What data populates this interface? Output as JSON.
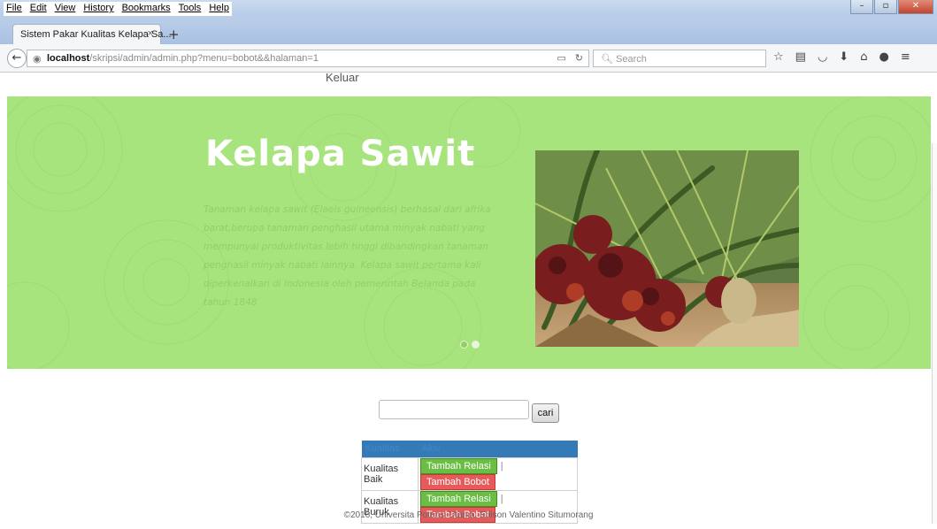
{
  "browser": {
    "menu": [
      "File",
      "Edit",
      "View",
      "History",
      "Bookmarks",
      "Tools",
      "Help"
    ],
    "tab_title": "Sistem Pakar Kualitas Kelapa Sa...",
    "tab_close": "×",
    "new_tab": "+",
    "url_host": "localhost",
    "url_path": "/skripsi/admin/admin.php?menu=bobot&&halaman=1",
    "search_placeholder": "Search",
    "toolbar_icons": [
      "star-icon",
      "bookmarks-list-icon",
      "pocket-icon",
      "download-icon",
      "home-icon",
      "hello-icon",
      "menu-icon"
    ]
  },
  "page": {
    "logout_label": "Keluar",
    "hero": {
      "title": "Kelapa Sawit",
      "description": "Tanaman kelapa sawit (Elaeis guineensis) berhasal dari afrika barat,berupa tanaman penghasil utama minyak nabati yang mempunyai produktivitas lebih tinggi dibandingkan tanaman penghasil minyak nabati lainnya. Kelapa sawit pertama kali diperkenalkan di Indonesia oleh pemerintah Belanda pada tahun 1848",
      "background_color": "#a8e47e",
      "slide_count": 2,
      "active_slide": 1
    },
    "search": {
      "input_value": "",
      "button_label": "cari"
    },
    "table": {
      "headers": [
        "Kualitas",
        "Aksi"
      ],
      "rows": [
        {
          "kualitas": "Kualitas Baik",
          "relasi_label": "Tambah Relasi",
          "separator": "|",
          "bobot_label": "Tambah Bobot"
        },
        {
          "kualitas": "Kualitas Buruk",
          "relasi_label": "Tambah Relasi",
          "separator": "|",
          "bobot_label": "Tambah Bobot"
        }
      ]
    },
    "footer": "©2016, Universita Potensi Utama, Edison Valentino Situmorang"
  }
}
